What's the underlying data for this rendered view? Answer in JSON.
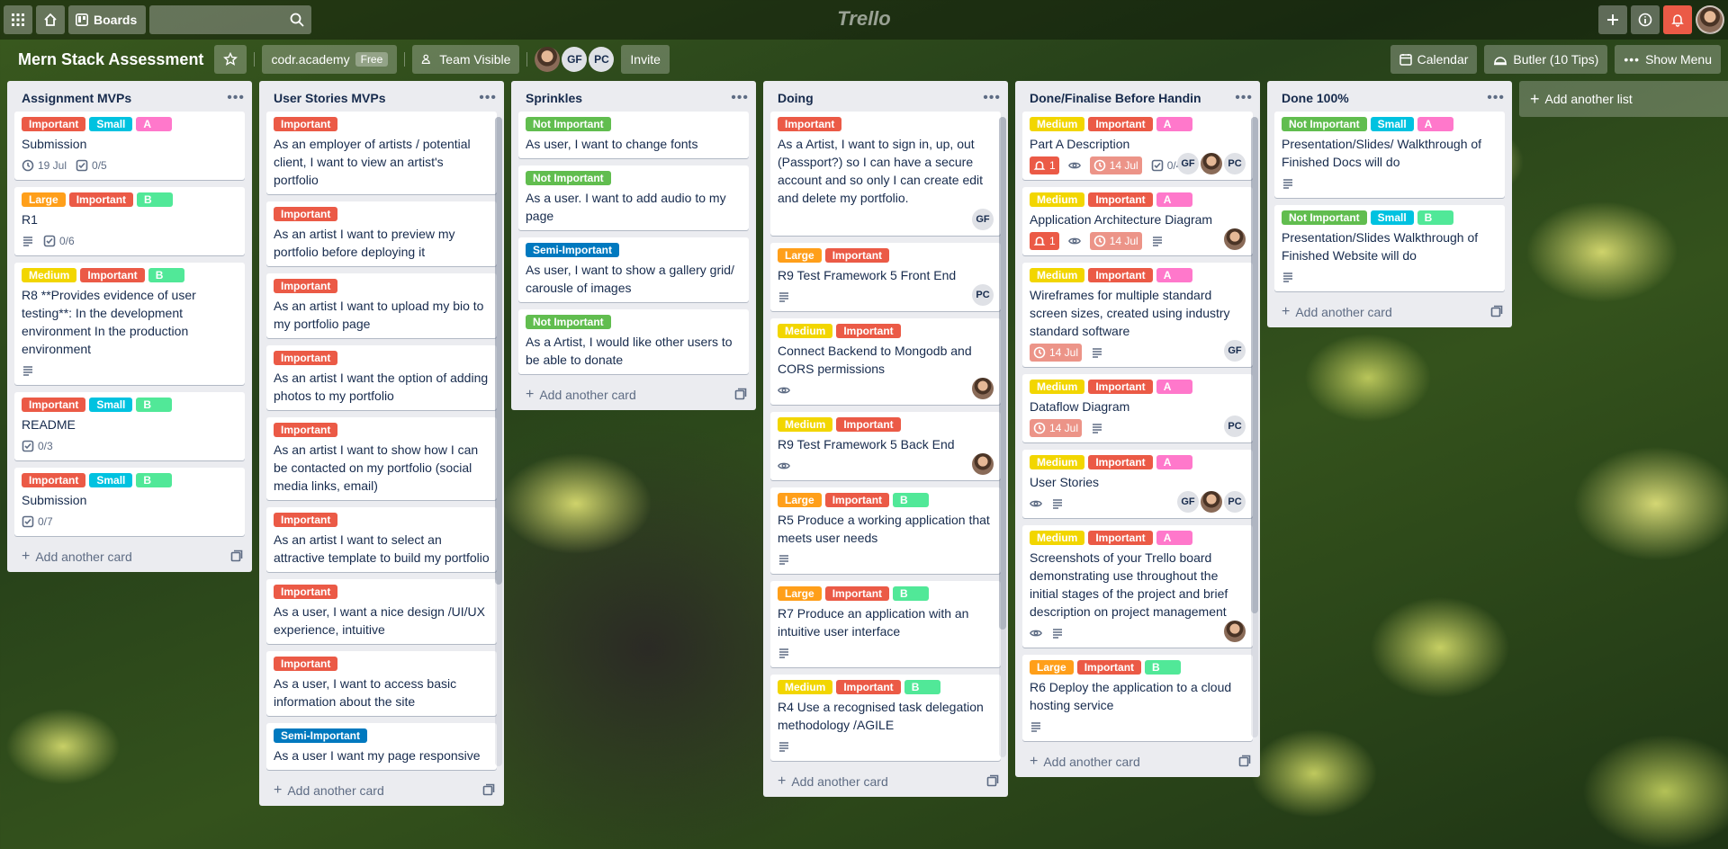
{
  "topbar": {
    "boards_label": "Boards",
    "logo": "Trello"
  },
  "board": {
    "title": "Mern Stack Assessment",
    "workspace": "codr.academy",
    "plan": "Free",
    "visibility": "Team Visible",
    "members": [
      "GF",
      "PC"
    ],
    "invite": "Invite",
    "calendar": "Calendar",
    "butler": "Butler (10 Tips)",
    "show_menu": "Show Menu"
  },
  "lists": [
    {
      "title": "Assignment MVPs",
      "add_card": "Add another card",
      "cards": [
        {
          "labels": [
            {
              "text": "Important",
              "color": "red"
            },
            {
              "text": "Small",
              "color": "blue"
            },
            {
              "text": "A",
              "color": "pink"
            }
          ],
          "title": "Submission",
          "badges": [
            {
              "type": "clock",
              "text": "19 Jul"
            },
            {
              "type": "check",
              "text": "0/5"
            }
          ]
        },
        {
          "labels": [
            {
              "text": "Large",
              "color": "orange"
            },
            {
              "text": "Important",
              "color": "red"
            },
            {
              "text": "B",
              "color": "lime"
            }
          ],
          "title": "R1",
          "badges": [
            {
              "type": "desc",
              "text": ""
            },
            {
              "type": "check",
              "text": "0/6"
            }
          ]
        },
        {
          "labels": [
            {
              "text": "Medium",
              "color": "yellow"
            },
            {
              "text": "Important",
              "color": "red"
            },
            {
              "text": "B",
              "color": "lime"
            }
          ],
          "title": "R8 **Provides evidence of user testing**: In the development environment In the production environment",
          "badges": [
            {
              "type": "desc",
              "text": ""
            }
          ]
        },
        {
          "labels": [
            {
              "text": "Important",
              "color": "red"
            },
            {
              "text": "Small",
              "color": "blue"
            },
            {
              "text": "B",
              "color": "lime"
            }
          ],
          "title": "README",
          "badges": [
            {
              "type": "check",
              "text": "0/3"
            }
          ]
        },
        {
          "labels": [
            {
              "text": "Important",
              "color": "red"
            },
            {
              "text": "Small",
              "color": "blue"
            },
            {
              "text": "B",
              "color": "lime"
            }
          ],
          "title": "Submission",
          "badges": [
            {
              "type": "check",
              "text": "0/7"
            }
          ]
        }
      ]
    },
    {
      "title": "User Stories MVPs",
      "add_card": "Add another card",
      "cards": [
        {
          "labels": [
            {
              "text": "Important",
              "color": "red"
            }
          ],
          "title": "As an employer of artists / potential client, I want to view an artist's portfolio"
        },
        {
          "labels": [
            {
              "text": "Important",
              "color": "red"
            }
          ],
          "title": "As an artist I want to preview my portfolio before deploying it"
        },
        {
          "labels": [
            {
              "text": "Important",
              "color": "red"
            }
          ],
          "title": "As an artist I want to upload my bio to my portfolio page"
        },
        {
          "labels": [
            {
              "text": "Important",
              "color": "red"
            }
          ],
          "title": "As an artist I want the option of adding photos to my portfolio"
        },
        {
          "labels": [
            {
              "text": "Important",
              "color": "red"
            }
          ],
          "title": "As an artist I want to show how I can be contacted on my portfolio (social media links, email)"
        },
        {
          "labels": [
            {
              "text": "Important",
              "color": "red"
            }
          ],
          "title": "As an artist I want to select an attractive template to build my portfolio"
        },
        {
          "labels": [
            {
              "text": "Important",
              "color": "red"
            }
          ],
          "title": "As a user, I want a nice design /UI/UX experience, intuitive"
        },
        {
          "labels": [
            {
              "text": "Important",
              "color": "red"
            }
          ],
          "title": "As a user, I want to access basic information about the site"
        },
        {
          "labels": [
            {
              "text": "Semi-Important",
              "color": "sky"
            }
          ],
          "title": "As a user I want my page responsive"
        }
      ]
    },
    {
      "title": "Sprinkles",
      "add_card": "Add another card",
      "cards": [
        {
          "labels": [
            {
              "text": "Not Important",
              "color": "green"
            }
          ],
          "title": "As user, I want to change fonts"
        },
        {
          "labels": [
            {
              "text": "Not Important",
              "color": "green"
            }
          ],
          "title": "As a user. I want to add audio to my page"
        },
        {
          "labels": [
            {
              "text": "Semi-Important",
              "color": "sky"
            }
          ],
          "title": "As user, I want to show a gallery grid/ carousle of images"
        },
        {
          "labels": [
            {
              "text": "Not Important",
              "color": "green"
            }
          ],
          "title": "As a Artist, I would like other users to be able to donate"
        }
      ]
    },
    {
      "title": "Doing",
      "add_card": "Add another card",
      "cards": [
        {
          "labels": [
            {
              "text": "Important",
              "color": "red"
            }
          ],
          "title": "As a Artist, I want to sign in, up, out (Passport?) so I can have a secure account and so only I can create edit and delete my portfolio.",
          "members": [
            "GF"
          ]
        },
        {
          "labels": [
            {
              "text": "Large",
              "color": "orange"
            },
            {
              "text": "Important",
              "color": "red"
            }
          ],
          "title": "R9 Test Framework 5 Front End",
          "badges": [
            {
              "type": "desc",
              "text": ""
            }
          ],
          "members": [
            "PC"
          ]
        },
        {
          "labels": [
            {
              "text": "Medium",
              "color": "yellow"
            },
            {
              "text": "Important",
              "color": "red"
            }
          ],
          "title": "Connect Backend to Mongodb and CORS permissions",
          "badges": [
            {
              "type": "eye",
              "text": ""
            }
          ],
          "members": [
            "photo"
          ]
        },
        {
          "labels": [
            {
              "text": "Medium",
              "color": "yellow"
            },
            {
              "text": "Important",
              "color": "red"
            }
          ],
          "title": "R9 Test Framework 5 Back End",
          "badges": [
            {
              "type": "eye",
              "text": ""
            }
          ],
          "members": [
            "photo"
          ]
        },
        {
          "labels": [
            {
              "text": "Large",
              "color": "orange"
            },
            {
              "text": "Important",
              "color": "red"
            },
            {
              "text": "B",
              "color": "lime"
            }
          ],
          "title": "R5 Produce a working application that meets user needs",
          "badges": [
            {
              "type": "desc",
              "text": ""
            }
          ]
        },
        {
          "labels": [
            {
              "text": "Large",
              "color": "orange"
            },
            {
              "text": "Important",
              "color": "red"
            },
            {
              "text": "B",
              "color": "lime"
            }
          ],
          "title": "R7 Produce an application with an intuitive user interface",
          "badges": [
            {
              "type": "desc",
              "text": ""
            }
          ]
        },
        {
          "labels": [
            {
              "text": "Medium",
              "color": "yellow"
            },
            {
              "text": "Important",
              "color": "red"
            },
            {
              "text": "B",
              "color": "lime"
            }
          ],
          "title": "R4 Use a recognised task delegation methodology /AGILE",
          "badges": [
            {
              "type": "desc",
              "text": ""
            }
          ]
        }
      ]
    },
    {
      "title": "Done/Finalise Before Handin",
      "add_card": "Add another card",
      "cards": [
        {
          "labels": [
            {
              "text": "Medium",
              "color": "yellow"
            },
            {
              "text": "Important",
              "color": "red"
            },
            {
              "text": "A",
              "color": "pink"
            }
          ],
          "title": "Part A Description",
          "badges": [
            {
              "type": "notif",
              "text": "1"
            },
            {
              "type": "eye",
              "text": ""
            },
            {
              "type": "due",
              "text": "14 Jul"
            },
            {
              "type": "check",
              "text": "0/4"
            }
          ],
          "members": [
            "GF",
            "photo",
            "PC"
          ]
        },
        {
          "labels": [
            {
              "text": "Medium",
              "color": "yellow"
            },
            {
              "text": "Important",
              "color": "red"
            },
            {
              "text": "A",
              "color": "pink"
            }
          ],
          "title": "Application Architecture Diagram",
          "badges": [
            {
              "type": "notif",
              "text": "1"
            },
            {
              "type": "eye",
              "text": ""
            },
            {
              "type": "due",
              "text": "14 Jul"
            },
            {
              "type": "desc",
              "text": ""
            }
          ],
          "members": [
            "photo"
          ]
        },
        {
          "labels": [
            {
              "text": "Medium",
              "color": "yellow"
            },
            {
              "text": "Important",
              "color": "red"
            },
            {
              "text": "A",
              "color": "pink"
            }
          ],
          "title": "Wireframes for multiple standard screen sizes, created using industry standard software",
          "badges": [
            {
              "type": "due",
              "text": "14 Jul"
            },
            {
              "type": "desc",
              "text": ""
            }
          ],
          "members": [
            "GF"
          ]
        },
        {
          "labels": [
            {
              "text": "Medium",
              "color": "yellow"
            },
            {
              "text": "Important",
              "color": "red"
            },
            {
              "text": "A",
              "color": "pink"
            }
          ],
          "title": "Dataflow Diagram",
          "badges": [
            {
              "type": "due",
              "text": "14 Jul"
            },
            {
              "type": "desc",
              "text": ""
            }
          ],
          "members": [
            "PC"
          ]
        },
        {
          "labels": [
            {
              "text": "Medium",
              "color": "yellow"
            },
            {
              "text": "Important",
              "color": "red"
            },
            {
              "text": "A",
              "color": "pink"
            }
          ],
          "title": "User Stories",
          "badges": [
            {
              "type": "eye",
              "text": ""
            },
            {
              "type": "desc",
              "text": ""
            }
          ],
          "members": [
            "GF",
            "photo",
            "PC"
          ]
        },
        {
          "labels": [
            {
              "text": "Medium",
              "color": "yellow"
            },
            {
              "text": "Important",
              "color": "red"
            },
            {
              "text": "A",
              "color": "pink"
            }
          ],
          "title": "Screenshots of your Trello board demonstrating use throughout the initial stages of the project and brief description on project management",
          "badges": [
            {
              "type": "eye",
              "text": ""
            },
            {
              "type": "desc",
              "text": ""
            }
          ],
          "members": [
            "photo"
          ]
        },
        {
          "labels": [
            {
              "text": "Large",
              "color": "orange"
            },
            {
              "text": "Important",
              "color": "red"
            },
            {
              "text": "B",
              "color": "lime"
            }
          ],
          "title": "R6 Deploy the application to a cloud hosting service",
          "badges": [
            {
              "type": "desc",
              "text": ""
            }
          ]
        }
      ]
    },
    {
      "title": "Done 100%",
      "add_card": "Add another card",
      "cards": [
        {
          "labels": [
            {
              "text": "Not Important",
              "color": "green"
            },
            {
              "text": "Small",
              "color": "blue"
            },
            {
              "text": "A",
              "color": "pink"
            }
          ],
          "title": "Presentation/Slides/ Walkthrough of Finished Docs will do",
          "badges": [
            {
              "type": "desc",
              "text": ""
            }
          ]
        },
        {
          "labels": [
            {
              "text": "Not Important",
              "color": "green"
            },
            {
              "text": "Small",
              "color": "blue"
            },
            {
              "text": "B",
              "color": "lime"
            }
          ],
          "title": "Presentation/Slides Walkthrough of Finished Website will do",
          "badges": [
            {
              "type": "desc",
              "text": ""
            }
          ]
        }
      ]
    }
  ],
  "add_list": "Add another list"
}
